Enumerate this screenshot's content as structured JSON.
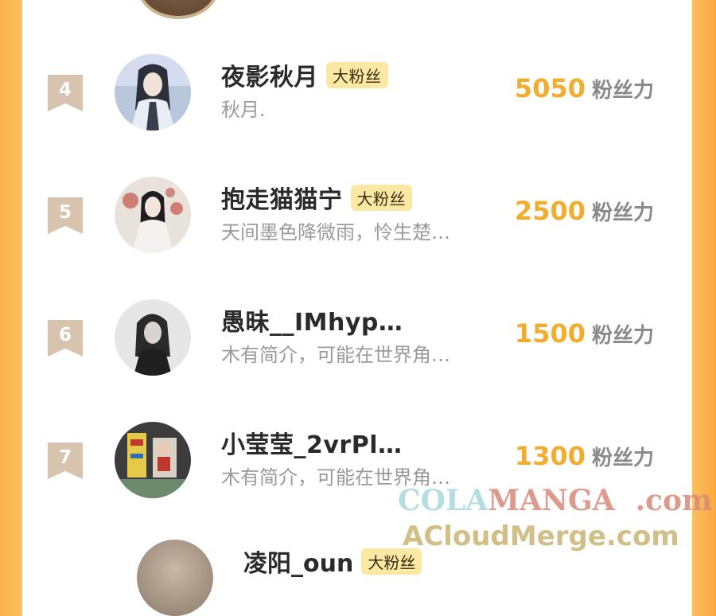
{
  "colors": {
    "accent_orange": "#f2ad2e",
    "badge_bg": "#fbe9a3",
    "rank_bg": "#d7c3ae",
    "frame_orange": "#fbb24a"
  },
  "ranking": [
    {
      "rank": "4",
      "name": "夜影秋月",
      "badge": "大粉丝",
      "intro": "秋月.",
      "score": "5050",
      "unit": "粉丝力"
    },
    {
      "rank": "5",
      "name": "抱走猫猫宁",
      "badge": "大粉丝",
      "intro": "天间墨色降微雨，怜生楚…",
      "score": "2500",
      "unit": "粉丝力"
    },
    {
      "rank": "6",
      "name": "愚昧__IMhyp…",
      "badge": "",
      "intro": "木有简介，可能在世界角…",
      "score": "1500",
      "unit": "粉丝力"
    },
    {
      "rank": "7",
      "name": "小莹莹_2vrPl…",
      "badge": "",
      "intro": "木有简介，可能在世界角…",
      "score": "1300",
      "unit": "粉丝力"
    }
  ],
  "partial_next": {
    "name": "凌阳_oun",
    "badge": "大粉丝"
  },
  "watermark": {
    "line1_a": "COLA",
    "line1_b": "MANGA",
    "line1_c": ".com",
    "line2": "ACloudMerge.com"
  }
}
